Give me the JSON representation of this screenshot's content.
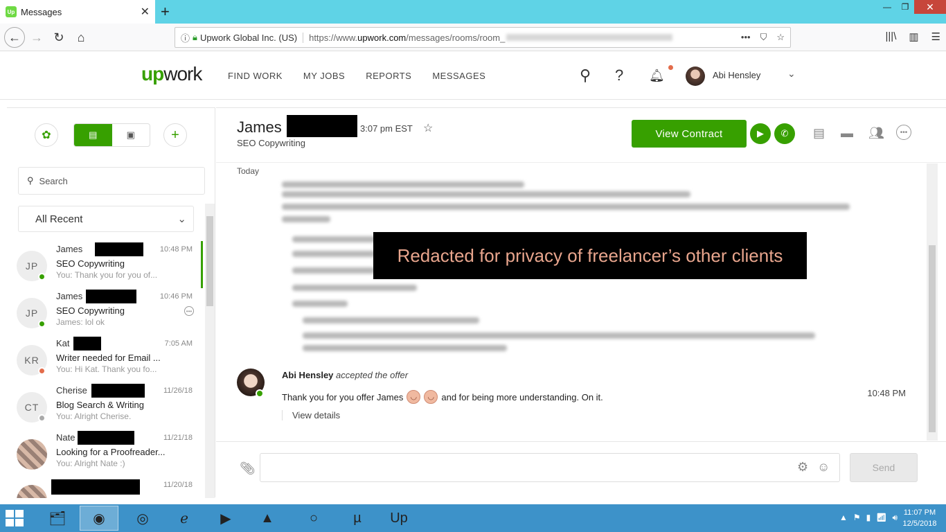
{
  "browser": {
    "tab_title": "Messages",
    "tab_favicon": "Up",
    "url_org": "Upwork Global Inc. (US)",
    "url_prefix": "https://www.",
    "url_host": "upwork.com",
    "url_path": "/messages/rooms/room_",
    "url_more": "•••"
  },
  "header": {
    "logo_up": "up",
    "logo_work": "work",
    "nav": [
      "FIND WORK",
      "MY JOBS",
      "REPORTS",
      "MESSAGES"
    ],
    "user_name": "Abi Hensley"
  },
  "sidebar": {
    "search_placeholder": "Search",
    "filter_label": "All Recent",
    "rooms": [
      {
        "initials": "JP",
        "name": "James",
        "time": "10:48 PM",
        "title": "SEO Copywriting",
        "snippet": "You: Thank you for you of...",
        "status_color": "#37a000"
      },
      {
        "initials": "JP",
        "name": "James",
        "time": "10:46 PM",
        "title": "SEO Copywriting",
        "snippet": "James: lol ok",
        "status_color": "#37a000",
        "more": "•••"
      },
      {
        "initials": "KR",
        "name": "Kat",
        "time": "7:05 AM",
        "title": "Writer needed for Email ...",
        "snippet": "You: Hi Kat. Thank you fo...",
        "status_color": "#e36c4b"
      },
      {
        "initials": "CT",
        "name": "Cherise",
        "time": "11/26/18",
        "title": "Blog Search & Writing",
        "snippet": "You: Alright Cherise.",
        "status_color": "#aaaaaa"
      },
      {
        "initials": "",
        "name": "Nate",
        "time": "11/21/18",
        "title": "Looking for a Proofreader...",
        "snippet": "You: Alright Nate :)",
        "status_color": "#aaaaaa"
      },
      {
        "initials": "",
        "name": "",
        "time": "11/20/18",
        "title": "",
        "snippet": ""
      }
    ]
  },
  "conversation": {
    "name": "James",
    "local_time": "3:07 pm EST",
    "subtitle": "SEO Copywriting",
    "view_contract": "View Contract",
    "day_label": "Today",
    "redaction_note": "Redacted for privacy of freelancer’s other clients",
    "message": {
      "author": "Abi Hensley",
      "action": "accepted the offer",
      "text_before": "Thank you for you offer James",
      "text_after": "and for being more understanding. On it.",
      "time": "10:48 PM",
      "details_link": "View details"
    }
  },
  "composer": {
    "placeholder": "",
    "send_label": "Send"
  },
  "taskbar": {
    "time": "11:07 PM",
    "date": "12/5/2018"
  },
  "colors": {
    "brand": "#37a000",
    "tabbar": "#5fd3e6",
    "taskbar": "#3d92c9"
  }
}
